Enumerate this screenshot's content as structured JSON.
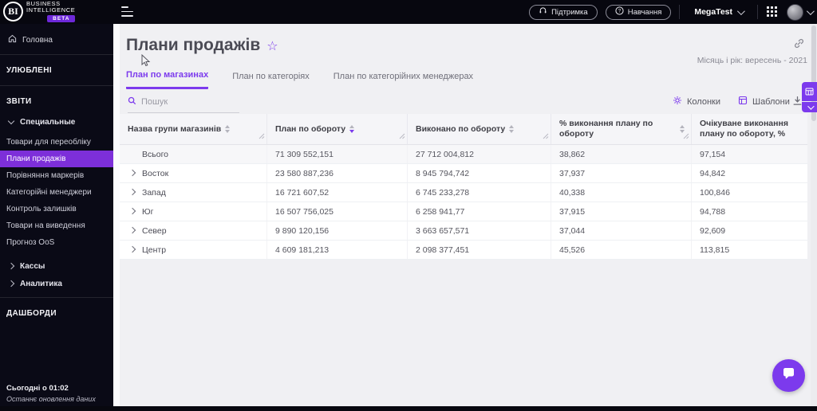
{
  "topbar": {
    "brand": {
      "initials": "BI",
      "name_line1": "BUSINESS",
      "name_line2": "INTELLIGENCE",
      "beta_badge": "BETA"
    },
    "support_button": "Підтримка",
    "training_button": "Навчання",
    "workspace": "MegaTest"
  },
  "sidebar": {
    "home": "Головна",
    "favorites_section": "УЛЮБЛЕНІ",
    "reports_section": "ЗВІТИ",
    "dashboards_section": "ДАШБОРДИ",
    "reports_group": "Специальные",
    "report_items": [
      "Товари для переобліку",
      "Плани продажів",
      "Порівняння маркерів",
      "Категорійні менеджери",
      "Контроль залишків",
      "Товари на виведення",
      "Прогноз OoS"
    ],
    "selected_item": "Плани продажів",
    "collapsed_groups": [
      "Кассы",
      "Аналитика"
    ],
    "last_update_time": "Сьогодні о 01:02",
    "last_update_caption": "Останнє оновлення даних"
  },
  "page": {
    "title": "Плани продажів",
    "period": "Місяць і рік: вересень - 2021",
    "tabs": [
      "План по магазинах",
      "План по категоріях",
      "План по категорійних менеджерах"
    ],
    "active_tab": "План по магазинах"
  },
  "toolbar": {
    "search_placeholder": "Пошук",
    "columns_button": "Колонки",
    "templates_button": "Шаблони"
  },
  "table": {
    "columns": [
      "Назва групи магазинів",
      "План по обороту",
      "Виконано по обороту",
      "% виконання плану по обороту",
      "Очікуване виконання плану по обороту, %"
    ],
    "sorted_column": "План по обороту",
    "sort_direction": "desc",
    "rows": [
      {
        "name": "Всього",
        "plan": "71 309 552,151",
        "actual": "27 712 004,812",
        "percent": "38,862",
        "expected": "97,154"
      },
      {
        "name": "Восток",
        "plan": "23 580 887,236",
        "actual": "8 945 794,742",
        "percent": "37,937",
        "expected": "94,842"
      },
      {
        "name": "Запад",
        "plan": "16 721 607,52",
        "actual": "6 745 233,278",
        "percent": "40,338",
        "expected": "100,846"
      },
      {
        "name": "Юг",
        "plan": "16 507 756,025",
        "actual": "6 258 941,77",
        "percent": "37,915",
        "expected": "94,788"
      },
      {
        "name": "Север",
        "plan": "9 890 120,156",
        "actual": "3 663 657,571",
        "percent": "37,044",
        "expected": "92,609"
      },
      {
        "name": "Центр",
        "plan": "4 609 181,213",
        "actual": "2 098 377,451",
        "percent": "45,526",
        "expected": "113,815"
      }
    ]
  },
  "colors": {
    "accent": "#7c3aed",
    "sidebar_selected_bg": "#7d2fd9",
    "topbar_bg": "#07070f",
    "content_bg": "#f0f0f3",
    "beta_badge_bg": "#6d28d9"
  }
}
